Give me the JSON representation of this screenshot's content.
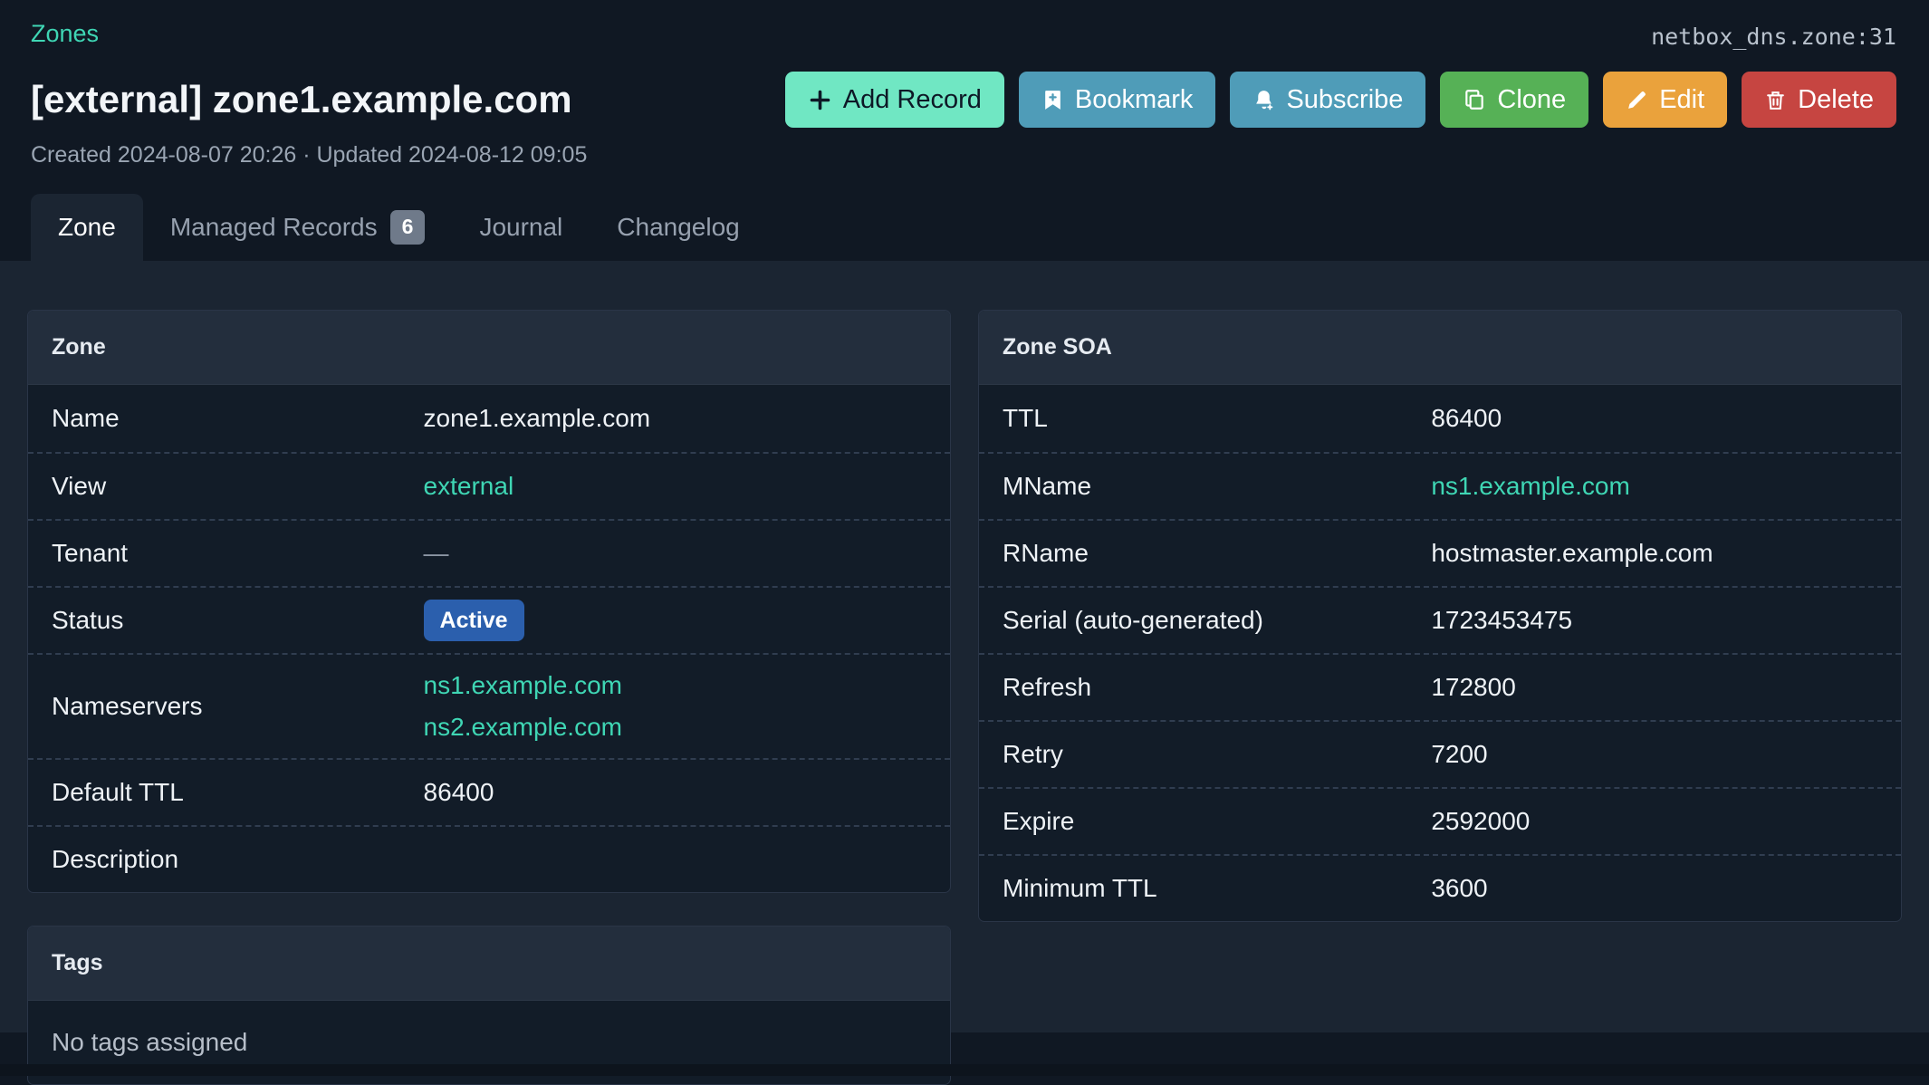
{
  "header": {
    "breadcrumb": "Zones",
    "object_id": "netbox_dns.zone:31",
    "title": "[external] zone1.example.com",
    "meta": "Created 2024-08-07 20:26 · Updated 2024-08-12 09:05",
    "buttons": [
      {
        "label": "Add Record",
        "icon": "plus-icon",
        "color": "#70e7c3"
      },
      {
        "label": "Bookmark",
        "icon": "bookmark-icon",
        "color": "#4f9cb8"
      },
      {
        "label": "Subscribe",
        "icon": "bell-icon",
        "color": "#4f9cb8"
      },
      {
        "label": "Clone",
        "icon": "copy-icon",
        "color": "#56b156"
      },
      {
        "label": "Edit",
        "icon": "pencil-icon",
        "color": "#eaa23c"
      },
      {
        "label": "Delete",
        "icon": "trash-icon",
        "color": "#c64541"
      }
    ]
  },
  "tabs": [
    {
      "label": "Zone",
      "active": true
    },
    {
      "label": "Managed Records",
      "badge": "6"
    },
    {
      "label": "Journal"
    },
    {
      "label": "Changelog"
    }
  ],
  "panels": {
    "zone": {
      "title": "Zone",
      "rows": [
        {
          "label": "Name",
          "value": "zone1.example.com"
        },
        {
          "label": "View",
          "value": "external"
        },
        {
          "label": "Tenant",
          "value": "—"
        },
        {
          "label": "Status",
          "value": "Active"
        },
        {
          "label": "Nameservers",
          "values": [
            "ns1.example.com",
            "ns2.example.com"
          ]
        },
        {
          "label": "Default TTL",
          "value": "86400"
        },
        {
          "label": "Description",
          "value": ""
        }
      ]
    },
    "soa": {
      "title": "Zone SOA",
      "rows": [
        {
          "label": "TTL",
          "value": "86400"
        },
        {
          "label": "MName",
          "value": "ns1.example.com"
        },
        {
          "label": "RName",
          "value": "hostmaster.example.com"
        },
        {
          "label": "Serial (auto-generated)",
          "value": "1723453475"
        },
        {
          "label": "Refresh",
          "value": "172800"
        },
        {
          "label": "Retry",
          "value": "7200"
        },
        {
          "label": "Expire",
          "value": "2592000"
        },
        {
          "label": "Minimum TTL",
          "value": "3600"
        }
      ]
    },
    "tags": {
      "title": "Tags",
      "empty_text": "No tags assigned"
    }
  },
  "colors": {
    "page_bg": "#101823",
    "content_bg": "#1b2532",
    "card_bg": "#121c28",
    "card_header_bg": "#232e3d",
    "link": "#3fd6b4",
    "status_active_badge": "#2b5fad",
    "button_add": "#70e7c3",
    "button_neutral": "#4f9cb8",
    "button_clone": "#56b156",
    "button_edit": "#eaa23c",
    "button_delete": "#c64541"
  }
}
